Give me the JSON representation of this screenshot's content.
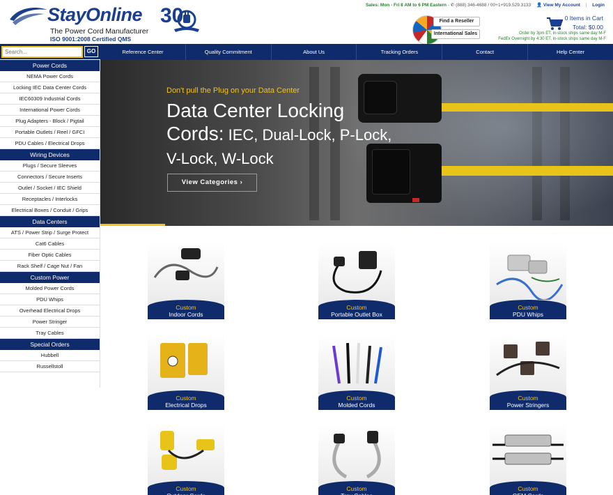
{
  "brand": {
    "name": "StayOnline",
    "anniversary": "30",
    "tagline": "The Power Cord Manufacturer",
    "iso": "ISO 9001:2008 Certified QMS"
  },
  "topbar": {
    "sales_hours": "Sales: Mon - Fri 8 AM to 6 PM Eastern",
    "phone": "(888) 346-4688 / 00+1+919.529.3133",
    "account": "View My Account",
    "separator": "|",
    "login": "Login"
  },
  "header_buttons": {
    "reseller": "Find a Reseller",
    "international": "International Sales"
  },
  "cart": {
    "count": "0 Items in Cart",
    "total": "Total: $0.00",
    "ship_line1": "Order by 3pm ET, in-stock ships same day M-F",
    "ship_line2": "FedEx Overnight by 4:30 ET, in-stock ships same day M-F"
  },
  "search": {
    "placeholder": "Search...",
    "go": "GO"
  },
  "nav": [
    "Reference Center",
    "Quality Commitment",
    "About Us",
    "Tracking Orders",
    "Contact",
    "Help Center"
  ],
  "sidebar": [
    {
      "heading": "Power Cords",
      "items": [
        "NEMA Power Cords",
        "Locking IEC Data Center Cords",
        "IEC60309 Industrial Cords",
        "International Power Cords",
        "Plug Adapters - Block / Pigtail",
        "Portable Outlets / Reel / GFCI",
        "PDU Cables / Electrical Drops"
      ]
    },
    {
      "heading": "Wiring Devices",
      "items": [
        "Plugs / Secure Sleeves",
        "Connectors / Secure Inserts",
        "Outlet / Socket / IEC Shield",
        "Receptacles / Interlocks",
        "Electrical Boxes / Conduit / Grips"
      ]
    },
    {
      "heading": "Data Centers",
      "items": [
        "ATS / Power Strip / Surge Protect",
        "Cat6 Cables",
        "Fiber Optic Cables",
        "Rack Shelf / Cage Nut / Fan"
      ]
    },
    {
      "heading": "Custom Power",
      "items": [
        "Molded Power Cords",
        "PDU Whips",
        "Overhead Electrical Drops",
        "Power Stringer",
        "Tray Cables"
      ]
    },
    {
      "heading": "Special Orders",
      "items": [
        "Hubbell",
        "Russellstoll"
      ]
    }
  ],
  "hero": {
    "kicker": "Don't pull the Plug on your Data Center",
    "title_line1": "Data Center Locking",
    "title_line2_big": "Cords:",
    "title_line2_rest": " IEC, Dual-Lock, P-Lock,",
    "title_line3": "V-Lock, W-Lock",
    "button": "View Categories ›"
  },
  "products": [
    {
      "prefix": "Custom",
      "name": "Indoor Cords",
      "icon": "indoor-cord-image"
    },
    {
      "prefix": "Custom",
      "name": "Portable Outlet Box",
      "icon": "outlet-box-image"
    },
    {
      "prefix": "Custom",
      "name": "PDU Whips",
      "icon": "pdu-whip-image"
    },
    {
      "prefix": "Custom",
      "name": "Electrical Drops",
      "icon": "electrical-drop-image"
    },
    {
      "prefix": "Custom",
      "name": "Molded Cords",
      "icon": "molded-cord-image"
    },
    {
      "prefix": "Custom",
      "name": "Power Stringers",
      "icon": "power-stringer-image"
    },
    {
      "prefix": "Custom",
      "name": "Outdoor Cords",
      "icon": "outdoor-cord-image"
    },
    {
      "prefix": "Custom",
      "name": "Tray Cables",
      "icon": "tray-cable-image"
    },
    {
      "prefix": "Custom",
      "name": "OEM Cords",
      "icon": "oem-cord-image"
    }
  ],
  "colors": {
    "navy": "#0f2b6b",
    "brand_blue": "#1b3f8f",
    "accent_yellow": "#f2c31b",
    "green": "#2e7d32"
  }
}
